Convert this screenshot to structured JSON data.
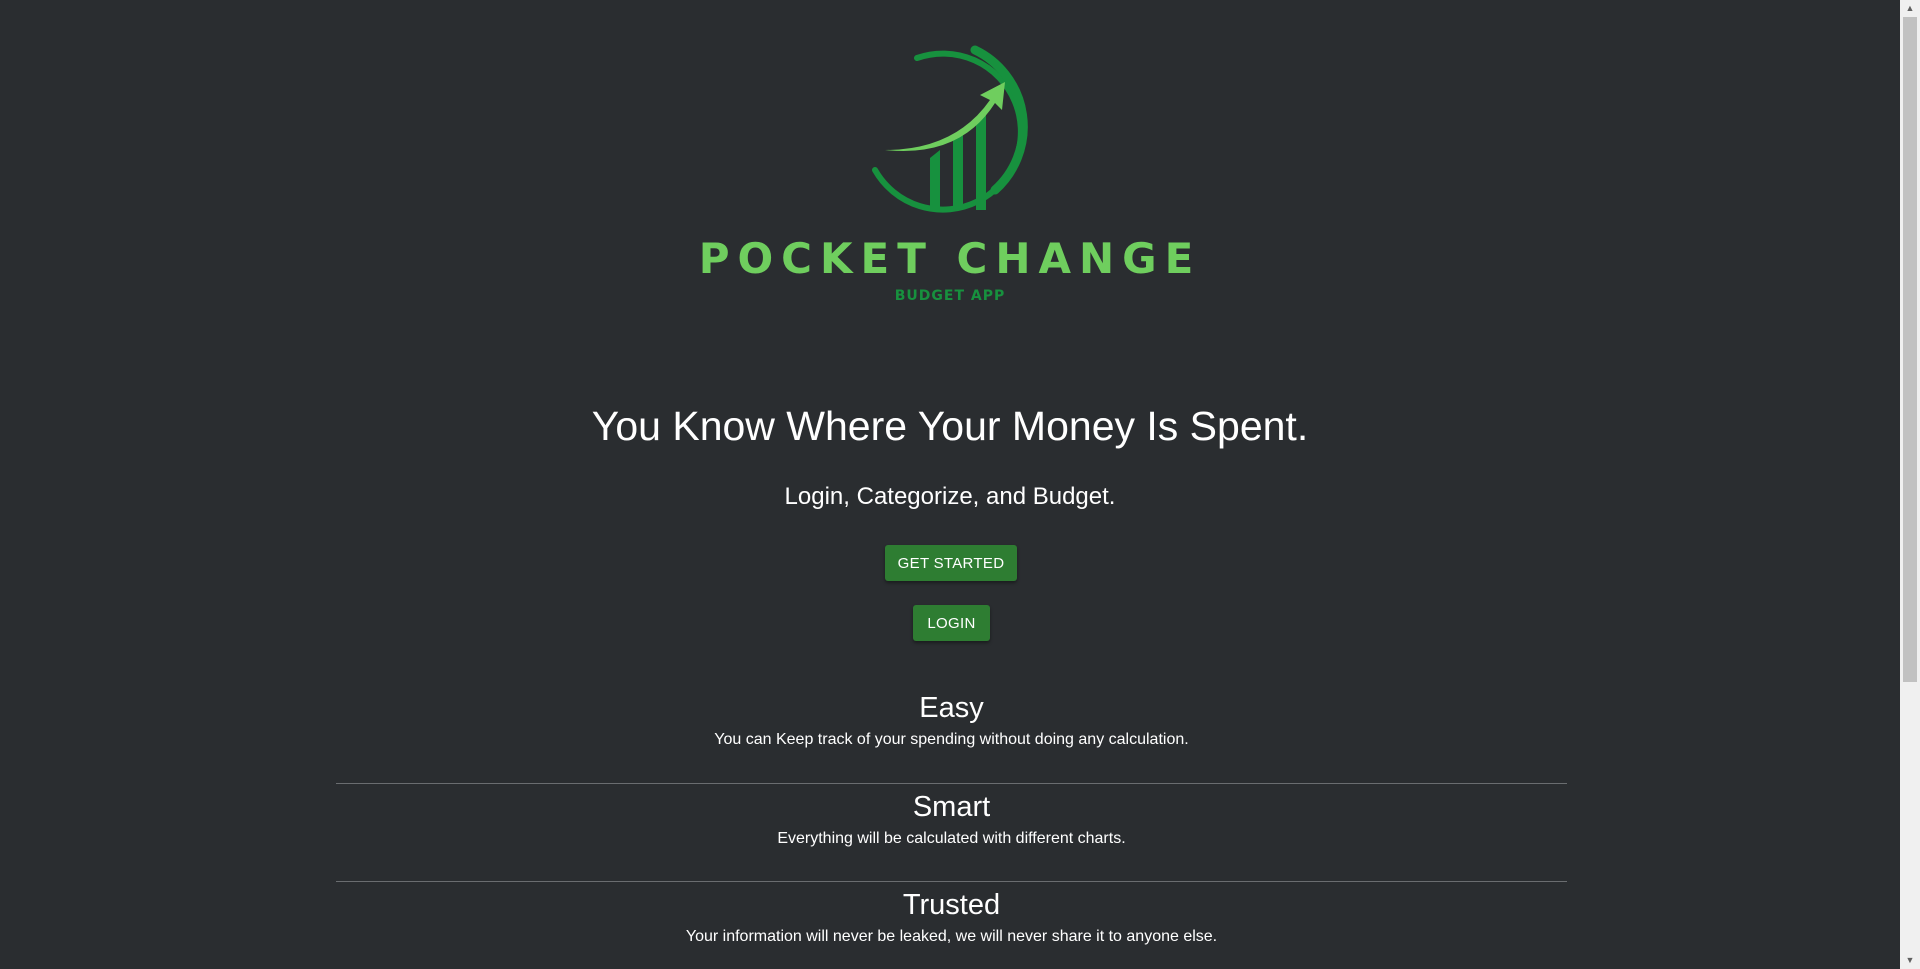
{
  "brand": {
    "name": "POCKET CHANGE",
    "tagline": "BUDGET APP",
    "colors": {
      "light_green": "#6fce5e",
      "dark_green": "#17913e"
    }
  },
  "hero": {
    "title": "You Know Where Your Money Is Spent.",
    "subtitle": "Login, Categorize, and Budget."
  },
  "actions": {
    "get_started_label": "GET STARTED",
    "login_label": "LOGIN"
  },
  "features": [
    {
      "title": "Easy",
      "text": "You can Keep track of your spending without doing any calculation."
    },
    {
      "title": "Smart",
      "text": "Everything will be calculated with different charts."
    },
    {
      "title": "Trusted",
      "text": "Your information will never be leaked, we will never share it to anyone else."
    }
  ],
  "theme": {
    "background": "#2a2d30",
    "button": "#2e7d32"
  },
  "scrollbar": {
    "up_icon": "triangle-up-icon",
    "down_icon": "triangle-down-icon"
  }
}
